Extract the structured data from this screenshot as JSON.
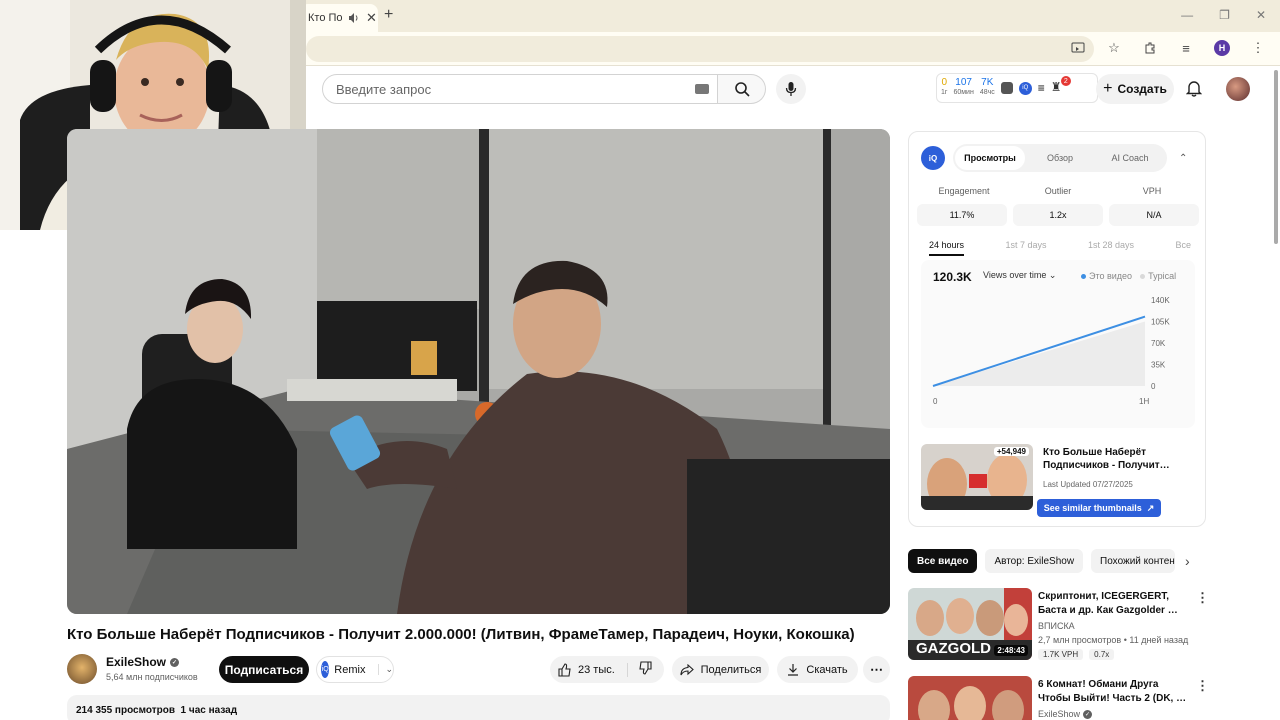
{
  "browser": {
    "tab_title": "Кто Подп",
    "tab_close": "✕",
    "new_tab": "+",
    "window_controls": [
      "—",
      "❐",
      "✕"
    ],
    "profile_initial": "H"
  },
  "masthead": {
    "search_placeholder": "Введите запрос",
    "vidiq": {
      "stats": [
        {
          "value": "0",
          "label": "1г"
        },
        {
          "value": "107",
          "label": "60мин"
        },
        {
          "value": "7K",
          "label": "48чс"
        }
      ],
      "logo_text": "iQ",
      "notification_count": "2"
    },
    "create_label": "Создать"
  },
  "video": {
    "title": "Кто Больше Наберёт Подписчиков - Получит 2.000.000! (Литвин, ФрамеТамер, Парадеич, Ноуки, Кокошка)",
    "channel_name": "ExileShow",
    "channel_subs": "5,64 млн подписчиков",
    "subscribe_label": "Подписаться",
    "remix_label": "Remix",
    "likes": "23 тыс.",
    "share_label": "Поделиться",
    "download_label": "Скачать",
    "description_meta": "214 355 просмотров  1 час назад"
  },
  "vidiq_panel": {
    "logo_text": "iQ",
    "tabs": [
      "Просмотры",
      "Обзор",
      "AI Coach"
    ],
    "active_tab": "Просмотры",
    "metrics": {
      "labels": [
        "Engagement",
        "Outlier",
        "VPH"
      ],
      "values": [
        "11.7%",
        "1.2x",
        "N/A"
      ]
    },
    "periods": [
      "24 hours",
      "1st 7 days",
      "1st 28 days",
      "Все"
    ],
    "total_views": "120.3K",
    "dropdown_label": "Views over time",
    "legend": {
      "this_video": "Это видео",
      "typical": "Typical"
    },
    "similar_card": {
      "badge": "+54,949",
      "title": "Кто Больше Наберёт Подписчиков - Получит…",
      "updated": "Last Updated 07/27/2025",
      "button_label": "See similar thumbnails"
    }
  },
  "chart_data": {
    "type": "line",
    "x_ticks": [
      "0",
      "1H"
    ],
    "y_ticks": [
      "0",
      "35K",
      "70K",
      "105K",
      "140K"
    ],
    "ylim": [
      0,
      140000
    ],
    "xlim": [
      0,
      1
    ],
    "series": [
      {
        "name": "Это видео",
        "x": [
          0,
          1
        ],
        "values": [
          0,
          113000
        ],
        "color": "#3d8fe3"
      },
      {
        "name": "Typical",
        "x": [
          0,
          1
        ],
        "values": [
          0,
          105000
        ],
        "color": "#d9d9d9"
      }
    ],
    "grid": false,
    "legend_position": "top-right"
  },
  "chips": [
    "Все видео",
    "Автор: ExileShow",
    "Похожий контент"
  ],
  "recommendations": [
    {
      "title": "Скриптонит, ICEGERGERT, Баста и др. Как Gazgolder …",
      "channel": "ВПИСКА",
      "meta": "2,7 млн просмотров • 11 дней назад",
      "duration": "2:48:43",
      "thumb_text": "GAZGOLD",
      "pills": [
        "1.7K VPH",
        "0.7x"
      ]
    },
    {
      "title": "6 Комнат! Обмани Друга Чтобы Выйти! Часть 2 (DK, …",
      "channel": "ExileShow",
      "meta": "",
      "duration": "",
      "thumb_text": "",
      "pills": []
    }
  ],
  "colors": {
    "accent_blue": "#2d5fd9",
    "chrome_bg": "#f1ecdc",
    "subscribe_bg": "#0f0f0f"
  }
}
